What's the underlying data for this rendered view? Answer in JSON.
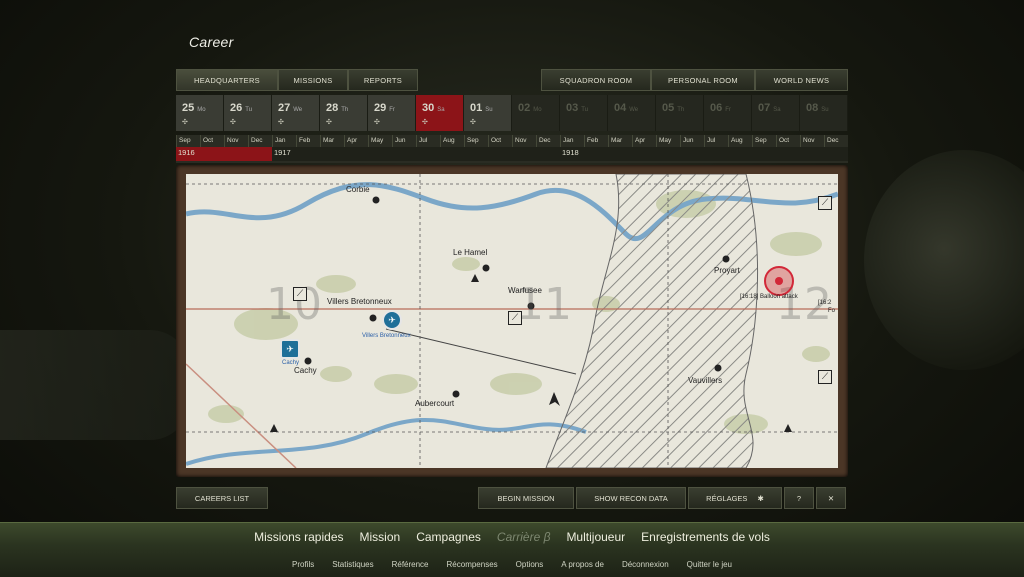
{
  "title": "Career",
  "tabs_left": [
    "HEADQUARTERS",
    "MISSIONS",
    "REPORTS"
  ],
  "tabs_right": [
    "SQUADRON ROOM",
    "PERSONAL ROOM",
    "WORLD NEWS"
  ],
  "days": [
    {
      "num": "25",
      "wd": "Mo",
      "state": "past"
    },
    {
      "num": "26",
      "wd": "Tu",
      "state": "past"
    },
    {
      "num": "27",
      "wd": "We",
      "state": "past"
    },
    {
      "num": "28",
      "wd": "Th",
      "state": "past"
    },
    {
      "num": "29",
      "wd": "Fr",
      "state": "past"
    },
    {
      "num": "30",
      "wd": "Sa",
      "state": "today"
    },
    {
      "num": "01",
      "wd": "Su",
      "state": "past"
    },
    {
      "num": "02",
      "wd": "Mo",
      "state": "future"
    },
    {
      "num": "03",
      "wd": "Tu",
      "state": "future"
    },
    {
      "num": "04",
      "wd": "We",
      "state": "future"
    },
    {
      "num": "05",
      "wd": "Th",
      "state": "future"
    },
    {
      "num": "06",
      "wd": "Fr",
      "state": "future"
    },
    {
      "num": "07",
      "wd": "Sa",
      "state": "future"
    },
    {
      "num": "08",
      "wd": "Su",
      "state": "future"
    }
  ],
  "months": [
    "Sep",
    "Oct",
    "Nov",
    "Dec",
    "Jan",
    "Feb",
    "Mar",
    "Apr",
    "May",
    "Jun",
    "Jul",
    "Aug",
    "Sep",
    "Oct",
    "Nov",
    "Dec",
    "Jan",
    "Feb",
    "Mar",
    "Apr",
    "May",
    "Jun",
    "Jul",
    "Aug",
    "Sep",
    "Oct",
    "Nov",
    "Dec"
  ],
  "years": [
    "1916",
    "1917",
    "1918"
  ],
  "map": {
    "places": [
      "Corbie",
      "Le Hamel",
      "Warfusee",
      "Proyart",
      "Villers Bretonneux",
      "Cachy",
      "Aubercourt",
      "Vauvillers"
    ],
    "grid_numbers": [
      "10",
      "11",
      "12"
    ],
    "airfield_labels": [
      "Villers Bretonneux",
      "Cachy"
    ],
    "event_label": "[16:18] Balloon attack",
    "event_label_cut": "[16:2",
    "event_label_cut2": "Fo"
  },
  "buttons": {
    "careers_list": "CAREERS LIST",
    "begin_mission": "BEGIN MISSION",
    "show_recon": "SHOW RECON DATA",
    "reglages": "RÉGLAGES",
    "help_icon": "?",
    "close_icon": "✕"
  },
  "main_nav": [
    "Missions rapides",
    "Mission",
    "Campagnes",
    "Carrière β",
    "Multijoueur",
    "Enregistrements de vols"
  ],
  "sub_nav": [
    "Profils",
    "Statistiques",
    "Référence",
    "Récompenses",
    "Options",
    "A propos de",
    "Déconnexion",
    "Quitter le jeu"
  ],
  "colors": {
    "accent_red": "#8c1418",
    "airfield_blue": "#1f6f99",
    "target_red": "#d22838",
    "panel_olive": "#3a3e30"
  }
}
